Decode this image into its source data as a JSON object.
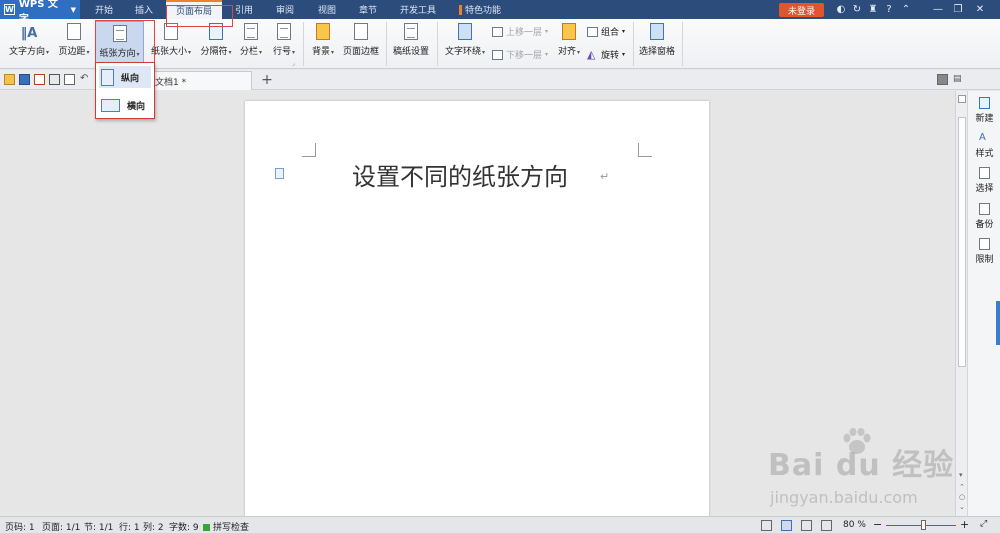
{
  "app": {
    "name": "WPS 文字"
  },
  "menu": {
    "tabs": [
      "开始",
      "插入",
      "页面布局",
      "引用",
      "审阅",
      "视图",
      "章节",
      "开发工具",
      "特色功能"
    ],
    "active": "页面布局",
    "login": "未登录",
    "help": "?"
  },
  "ribbon": {
    "text_direction": "文字方向",
    "margins": "页边距",
    "orientation": "纸张方向",
    "paper_size": "纸张大小",
    "breaks": "分隔符",
    "columns": "分栏",
    "line_numbers": "行号",
    "background": "背景",
    "page_border": "页面边框",
    "manuscript": "稿纸设置",
    "text_wrap": "文字环绕",
    "bring_forward": "上移一层",
    "send_backward": "下移一层",
    "align": "对齐",
    "group": "组合",
    "rotate": "旋转",
    "selection_pane": "选择窗格"
  },
  "orientation_menu": {
    "portrait": "纵向",
    "landscape": "横向"
  },
  "document": {
    "tab_title": "文档1 *",
    "body_text": "设置不同的纸张方向"
  },
  "right_panel": [
    "新建",
    "样式",
    "选择",
    "备份",
    "限制"
  ],
  "status": {
    "page_code": "页码: 1",
    "pages": "页面: 1/1",
    "section": "节: 1/1",
    "row": "行: 1",
    "col": "列: 2",
    "word_count": "字数: 9",
    "spell_check": "拼写检查",
    "zoom": "80 %"
  },
  "watermark": {
    "brand": "Bai du 经验",
    "url": "jingyan.baidu.com"
  },
  "colors": {
    "title_bar": "#2c4c7c",
    "accent": "#2f6fc2",
    "login": "#e0552d",
    "annotation": "#e04545"
  }
}
